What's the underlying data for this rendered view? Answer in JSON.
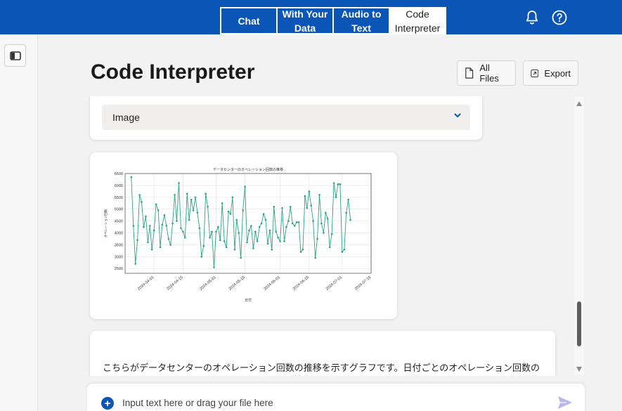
{
  "nav": {
    "tabs": [
      {
        "label": "Chat"
      },
      {
        "label": "With Your\nData"
      },
      {
        "label": "Audio to\nText"
      },
      {
        "label": "Code\nInterpreter"
      }
    ],
    "active_tab": 3
  },
  "header": {
    "title": "Code Interpreter",
    "all_files_label": "All Files",
    "export_label": "Export"
  },
  "conversation": {
    "accordion_label": "Image",
    "message_text": "こちらがデータセンターのオペレーション回数の推移を示すグラフです。日付ごとのオペレーション回数の合計をプロットしています。このグラフから、特定の日にオペレーション回数が多い日や少ない日が視覚的に確認できます。"
  },
  "input": {
    "placeholder": "Input text here or drag your file here"
  },
  "colors": {
    "brand": "#0a55b5",
    "series": "#2aa384"
  },
  "chart_data": {
    "type": "line",
    "title": "データセンターのオペレーション回数の推移",
    "xlabel": "日付",
    "ylabel": "オペレーション回数",
    "ylim": [
      2300,
      6500
    ],
    "xlim": [
      "2024-03-18",
      "2024-07-15"
    ],
    "x_ticks": [
      "2024-04-01",
      "2024-04-15",
      "2024-05-01",
      "2024-05-15",
      "2024-06-01",
      "2024-06-15",
      "2024-07-01",
      "2024-07-15"
    ],
    "y_ticks": [
      2500,
      3000,
      3500,
      4000,
      4500,
      5000,
      5500,
      6000,
      6500
    ],
    "grid": true,
    "x_start": "2024-03-21",
    "x_step_days": 1,
    "series": [
      {
        "values": [
          6350,
          4300,
          2700,
          3700,
          5600,
          5300,
          4250,
          4700,
          3600,
          4300,
          3300,
          4100,
          5200,
          4950,
          3400,
          4350,
          4750,
          4300,
          3750,
          3500,
          4400,
          5600,
          4500,
          6100,
          4200,
          4050,
          3800,
          5650,
          4550,
          5400,
          4950,
          5500,
          4850,
          4200,
          3000,
          3450,
          5650,
          5100,
          3800,
          4050,
          2550,
          4050,
          4250,
          3700,
          5250,
          3650,
          3400,
          4900,
          4800,
          5500,
          3300,
          4550,
          4000,
          2950,
          4950,
          5950,
          3600,
          4100,
          4300,
          3350,
          4050,
          3650,
          4250,
          4400,
          4800,
          4550,
          3550,
          4100,
          3300,
          5100,
          4050,
          3800,
          3650,
          5050,
          3650,
          4250,
          4500,
          5100,
          4400,
          4300,
          4450,
          4450,
          3200,
          3300,
          5550,
          5050,
          5750,
          5150,
          4500,
          2950,
          3750,
          5600,
          4400,
          4000,
          4850,
          4600,
          3400,
          3950,
          6100,
          5500,
          6050,
          6050,
          3200,
          3300,
          4850,
          5400,
          4550
        ]
      }
    ]
  }
}
